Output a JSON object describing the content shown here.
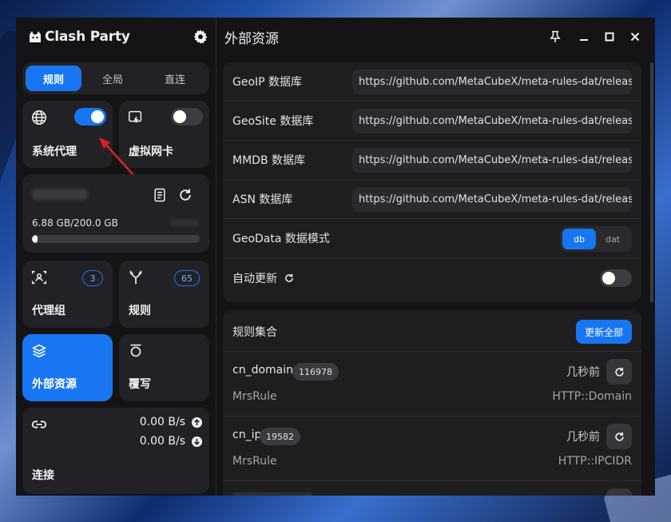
{
  "app": {
    "name": "Clash Party"
  },
  "modes": [
    {
      "label": "规则",
      "active": true
    },
    {
      "label": "全局",
      "active": false
    },
    {
      "label": "直连",
      "active": false
    }
  ],
  "cards": {
    "system_proxy": {
      "label": "系统代理",
      "enabled": true
    },
    "tun": {
      "label": "虚拟网卡",
      "enabled": false
    },
    "profile": {
      "usage": "6.88 GB/200.0 GB",
      "progress": 0.034
    },
    "proxy_groups": {
      "label": "代理组",
      "count": "3"
    },
    "rules": {
      "label": "规则",
      "count": "65"
    },
    "resources": {
      "label": "外部资源"
    },
    "override": {
      "label": "覆写"
    },
    "connections": {
      "label": "连接",
      "upload": "0.00 B/s",
      "download": "0.00 B/s"
    }
  },
  "page": {
    "title": "外部资源"
  },
  "geo": {
    "rows": [
      {
        "key": "GeoIP 数据库",
        "value": "https://github.com/MetaCubeX/meta-rules-dat/releas"
      },
      {
        "key": "GeoSite 数据库",
        "value": "https://github.com/MetaCubeX/meta-rules-dat/releas"
      },
      {
        "key": "MMDB 数据库",
        "value": "https://github.com/MetaCubeX/meta-rules-dat/releas"
      },
      {
        "key": "ASN 数据库",
        "value": "https://github.com/MetaCubeX/meta-rules-dat/releas"
      }
    ],
    "mode_label": "GeoData 数据模式",
    "mode_options": [
      "db",
      "dat"
    ],
    "auto_update_label": "自动更新",
    "auto_update_enabled": false
  },
  "ruleset": {
    "title": "规则集合",
    "update_all": "更新全部",
    "items": [
      {
        "name": "cn_domain",
        "count": "116978",
        "type": "MrsRule",
        "time": "几秒前",
        "source": "HTTP::Domain"
      },
      {
        "name": "cn_ip",
        "count": "19582",
        "type": "MrsRule",
        "time": "几秒前",
        "source": "HTTP::IPCIDR"
      }
    ]
  },
  "colors": {
    "accent": "#1876f2",
    "card": "#222226",
    "bg": "#141416"
  }
}
